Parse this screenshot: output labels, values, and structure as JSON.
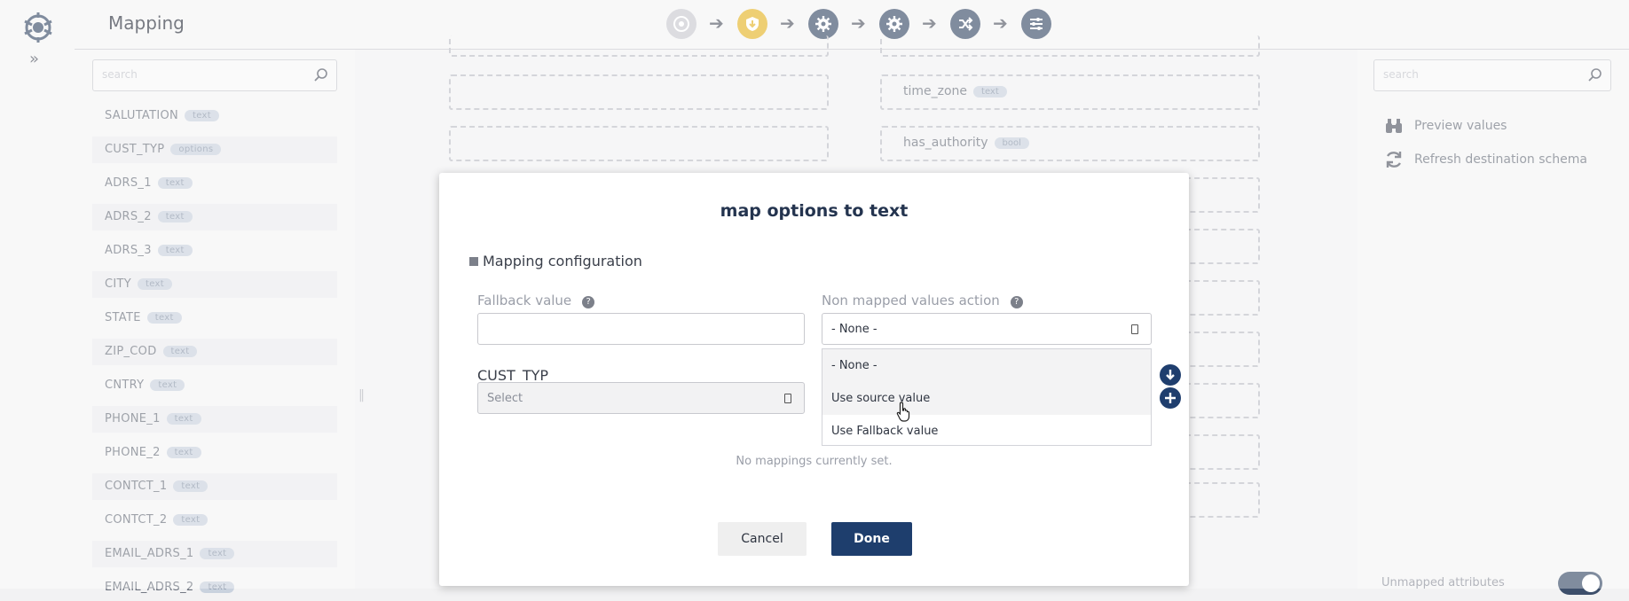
{
  "header": {
    "title": "Mapping",
    "steps": [
      {
        "icon": "source-logo-icon",
        "state": "done"
      },
      {
        "icon": "shield-download-icon",
        "state": "warning"
      },
      {
        "icon": "gear-icon",
        "state": "normal"
      },
      {
        "icon": "gear-icon",
        "state": "normal"
      },
      {
        "icon": "shuffle-icon",
        "state": "normal"
      },
      {
        "icon": "sliders-icon",
        "state": "normal"
      }
    ]
  },
  "left_panel": {
    "search_placeholder": "search",
    "attributes": [
      {
        "name": "SALUTATION",
        "type": "text"
      },
      {
        "name": "CUST_TYP",
        "type": "options"
      },
      {
        "name": "ADRS_1",
        "type": "text"
      },
      {
        "name": "ADRS_2",
        "type": "text"
      },
      {
        "name": "ADRS_3",
        "type": "text"
      },
      {
        "name": "CITY",
        "type": "text"
      },
      {
        "name": "STATE",
        "type": "text"
      },
      {
        "name": "ZIP_COD",
        "type": "text"
      },
      {
        "name": "CNTRY",
        "type": "text"
      },
      {
        "name": "PHONE_1",
        "type": "text"
      },
      {
        "name": "PHONE_2",
        "type": "text"
      },
      {
        "name": "CONTCT_1",
        "type": "text"
      },
      {
        "name": "CONTCT_2",
        "type": "text"
      },
      {
        "name": "EMAIL_ADRS_1",
        "type": "text"
      },
      {
        "name": "EMAIL_ADRS_2",
        "type": "text"
      }
    ]
  },
  "canvas": {
    "destination_fields": [
      {
        "name": "time_zone",
        "type": "text"
      },
      {
        "name": "has_authority",
        "type": "bool"
      }
    ]
  },
  "right_panel": {
    "search_placeholder": "search",
    "actions": [
      {
        "label": "Preview values",
        "icon": "binoculars-icon"
      },
      {
        "label": "Refresh destination schema",
        "icon": "refresh-icon"
      }
    ],
    "unmapped_label": "Unmapped attributes"
  },
  "modal": {
    "title": "map options to text",
    "section_title": "Mapping configuration",
    "fallback_label": "Fallback value",
    "fallback_value": "",
    "nonmapped_label": "Non mapped values action",
    "nonmapped_selected": "- None -",
    "nonmapped_options": [
      "- None -",
      "Use source value",
      "Use Fallback value"
    ],
    "source_field_label": "CUST_TYP",
    "source_select_placeholder": "Select",
    "no_mappings_text": "No mappings currently set.",
    "cancel_label": "Cancel",
    "done_label": "Done"
  },
  "colors": {
    "primary": "#1e3e6d",
    "step_bg": "#3d4f6b",
    "warning": "#e5b52a",
    "badge_bg": "#c9d2de"
  }
}
